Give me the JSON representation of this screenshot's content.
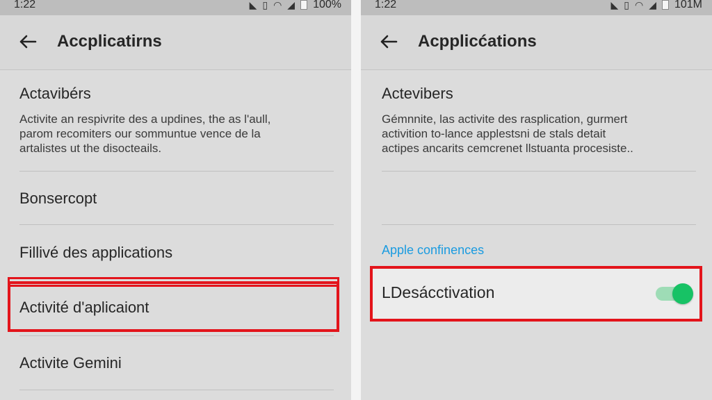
{
  "left": {
    "status": {
      "time": "1:22",
      "battery": "100%"
    },
    "title": "Accplicatirns",
    "section_title": "Actavibérs",
    "description": [
      "Activite an respivrite des a updines, the as l'aull,",
      "parom recomiters our sommuntue vence de la",
      "artalistes ut the disocteails."
    ],
    "items": [
      "Bonsercopt",
      "Fillivé des applications",
      "Activité d'aplicaiont",
      "Activite Gemini"
    ]
  },
  "right": {
    "status": {
      "time": "1:22",
      "battery": "101M"
    },
    "title": "Acpplicćations",
    "section_title": "Actevibers",
    "description": [
      "Gémnnite, las activite des rasplication, gurmert",
      "activition to-lance applestsni de stals detait",
      "actipes ancarits cemcrenet llstuanta procesiste.."
    ],
    "subheader": "Apple confinences",
    "toggle": {
      "label": "LDesácctivation",
      "state": "on"
    }
  },
  "colors": {
    "highlight": "#e3141b",
    "accent_blue": "#1a9be0",
    "switch_on": "#17c265"
  }
}
